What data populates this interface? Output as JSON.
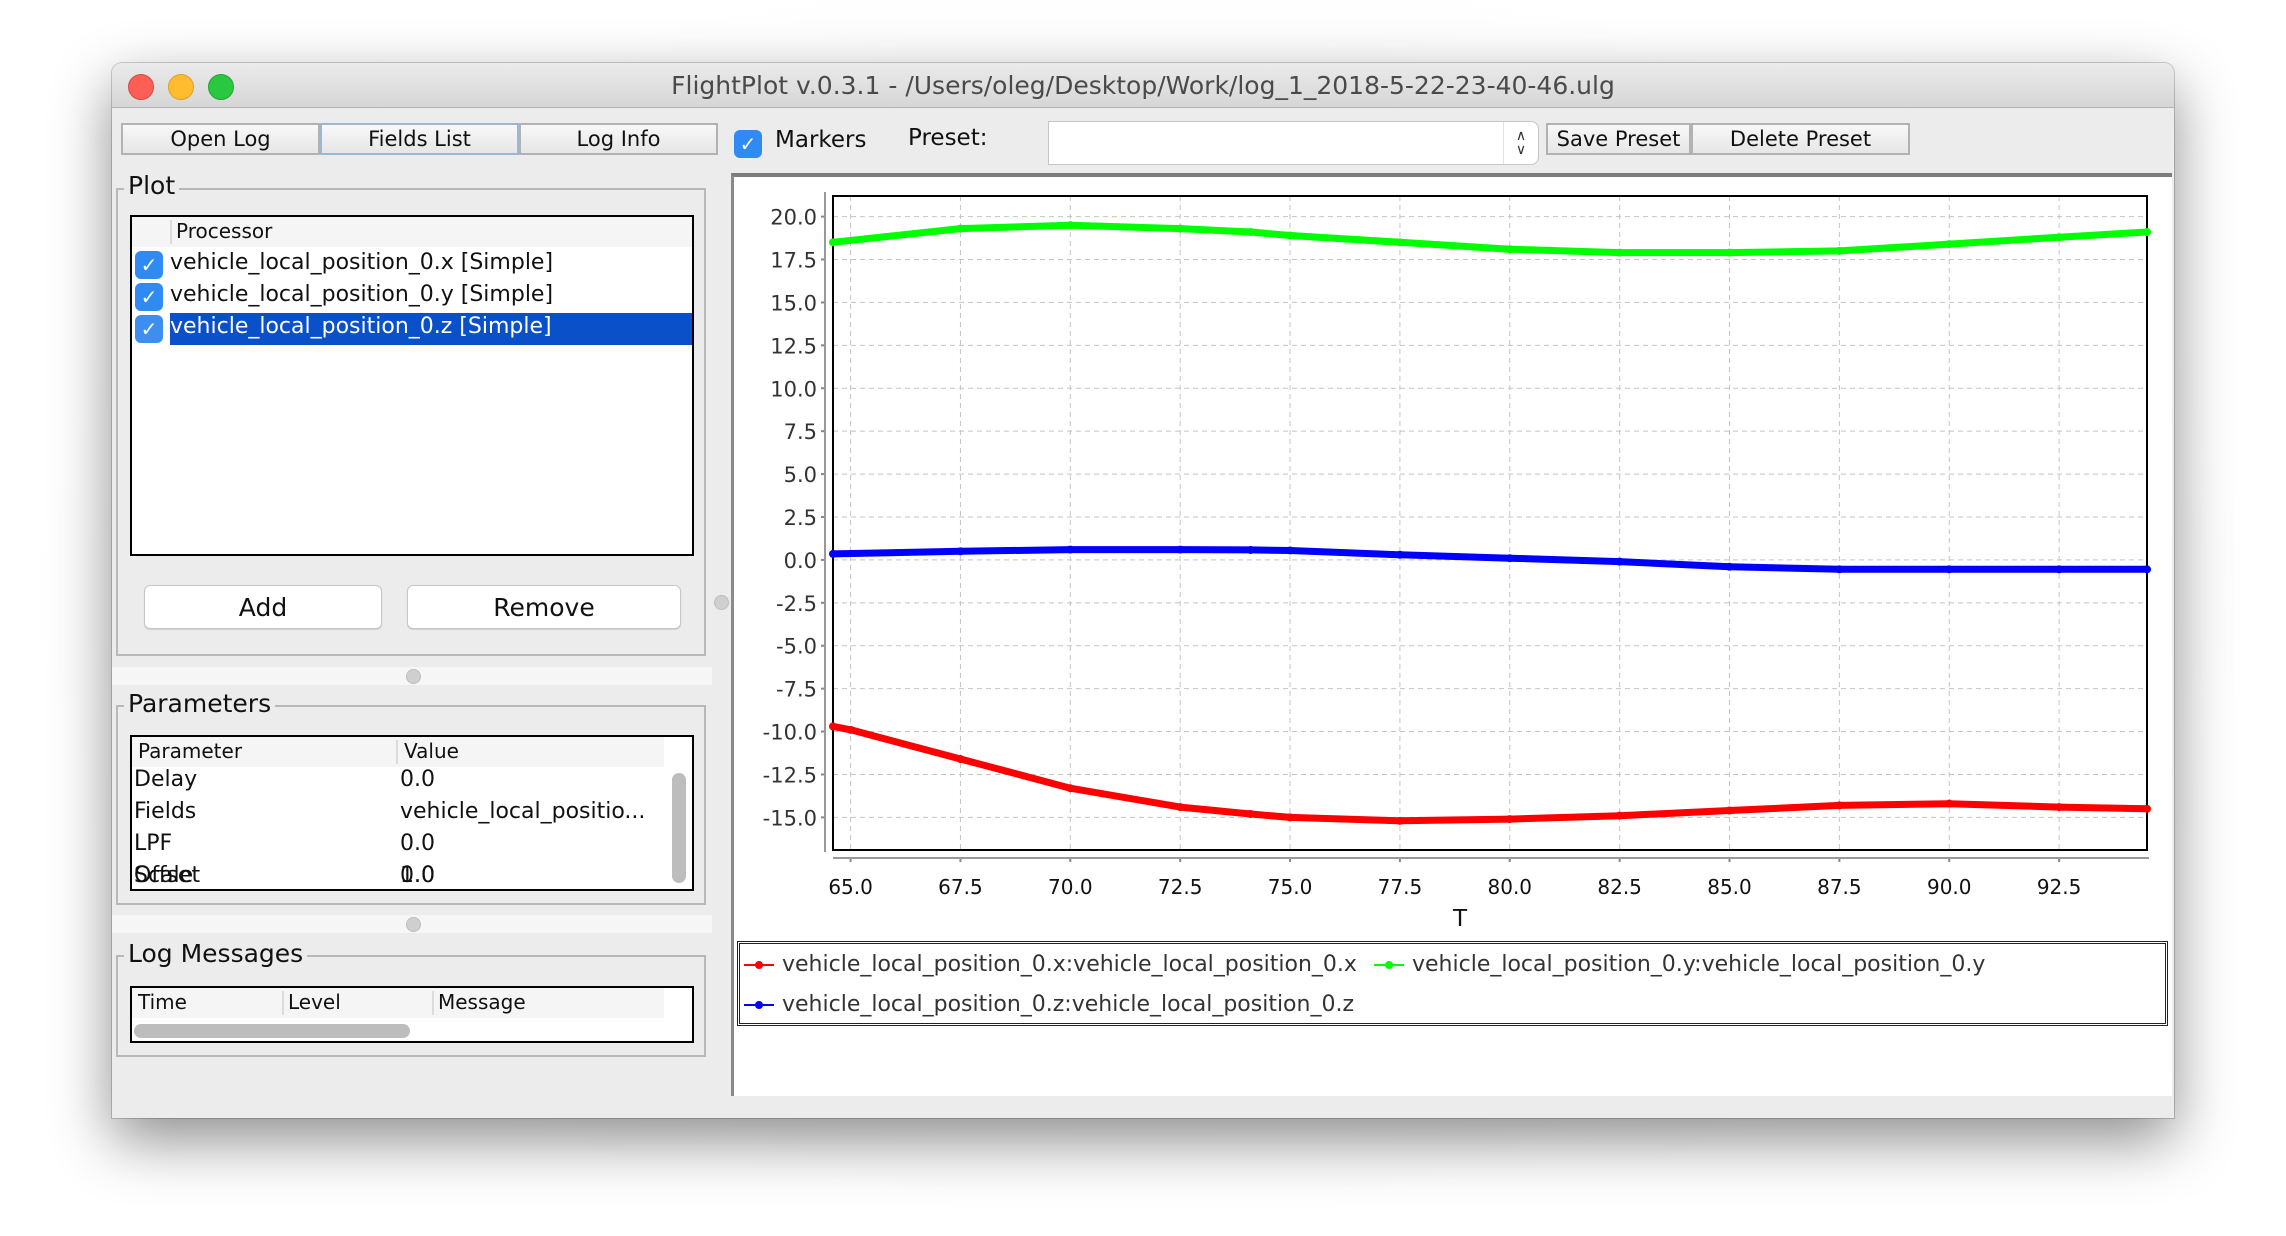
{
  "window": {
    "title": "FlightPlot v.0.3.1 - /Users/oleg/Desktop/Work/log_1_2018-5-22-23-40-46.ulg"
  },
  "toolbar": {
    "open_log": "Open Log",
    "fields_list": "Fields List",
    "log_info": "Log Info",
    "markers_label": "Markers",
    "markers_checked": true,
    "preset_label": "Preset:",
    "preset_value": "",
    "save_preset": "Save Preset",
    "delete_preset": "Delete Preset"
  },
  "plot_panel": {
    "title": "Plot",
    "column_header": "Processor",
    "rows": [
      {
        "label": "vehicle_local_position_0.x [Simple]",
        "checked": true,
        "selected": false
      },
      {
        "label": "vehicle_local_position_0.y [Simple]",
        "checked": true,
        "selected": false
      },
      {
        "label": "vehicle_local_position_0.z [Simple]",
        "checked": true,
        "selected": true
      }
    ],
    "add_button": "Add",
    "remove_button": "Remove"
  },
  "parameters_panel": {
    "title": "Parameters",
    "columns": [
      "Parameter",
      "Value"
    ],
    "rows": [
      {
        "name": "Delay",
        "value": "0.0"
      },
      {
        "name": "Fields",
        "value": "vehicle_local_positio..."
      },
      {
        "name": "LPF",
        "value": "0.0"
      },
      {
        "name": "Offset",
        "value": "0.0"
      },
      {
        "name": "Scale",
        "value": "1.0"
      }
    ]
  },
  "log_messages_panel": {
    "title": "Log Messages",
    "columns": [
      "Time",
      "Level",
      "Message"
    ]
  },
  "icons": {
    "check": "✓",
    "combo_up": "⌃",
    "combo_down": "⌄"
  },
  "colors": {
    "series_x": "#ff0000",
    "series_y": "#00ff00",
    "series_z": "#0000ff",
    "selection": "#0a50c8",
    "checkbox": "#2f8bf3"
  },
  "chart_data": {
    "type": "line",
    "title": "",
    "xlabel": "T",
    "ylabel": "",
    "xlim": [
      64.6,
      94.5
    ],
    "ylim": [
      -16.9,
      21.2
    ],
    "xticks": [
      "65.0",
      "67.5",
      "70.0",
      "72.5",
      "75.0",
      "77.5",
      "80.0",
      "82.5",
      "85.0",
      "87.5",
      "90.0",
      "92.5"
    ],
    "yticks": [
      "20.0",
      "17.5",
      "15.0",
      "12.5",
      "10.0",
      "7.5",
      "5.0",
      "2.5",
      "0.0",
      "-2.5",
      "-5.0",
      "-7.5",
      "-10.0",
      "-12.5",
      "-15.0"
    ],
    "grid": true,
    "legend_position": "bottom",
    "series": [
      {
        "name": "vehicle_local_position_0.x:vehicle_local_position_0.x",
        "color": "#ff0000",
        "x": [
          64.6,
          65.0,
          67.5,
          70.0,
          72.5,
          74.1,
          75.0,
          77.5,
          80.0,
          82.5,
          85.0,
          87.5,
          90.0,
          92.5,
          94.5
        ],
        "y": [
          -9.7,
          -9.9,
          -11.6,
          -13.3,
          -14.4,
          -14.8,
          -15.0,
          -15.2,
          -15.1,
          -14.9,
          -14.6,
          -14.3,
          -14.2,
          -14.4,
          -14.5
        ]
      },
      {
        "name": "vehicle_local_position_0.y:vehicle_local_position_0.y",
        "color": "#00ff00",
        "x": [
          64.6,
          67.5,
          70.0,
          72.5,
          74.1,
          75.0,
          77.5,
          80.0,
          82.5,
          85.0,
          87.5,
          90.0,
          92.5,
          94.5
        ],
        "y": [
          18.5,
          19.3,
          19.5,
          19.3,
          19.1,
          18.9,
          18.5,
          18.1,
          17.9,
          17.9,
          18.0,
          18.4,
          18.8,
          19.1
        ]
      },
      {
        "name": "vehicle_local_position_0.z:vehicle_local_position_0.z",
        "color": "#0000ff",
        "x": [
          64.6,
          67.5,
          70.0,
          72.5,
          74.1,
          75.0,
          77.5,
          80.0,
          82.5,
          85.0,
          87.5,
          90.0,
          92.5,
          94.5
        ],
        "y": [
          0.35,
          0.5,
          0.6,
          0.6,
          0.58,
          0.55,
          0.3,
          0.1,
          -0.1,
          -0.4,
          -0.55,
          -0.55,
          -0.55,
          -0.55
        ]
      }
    ]
  }
}
